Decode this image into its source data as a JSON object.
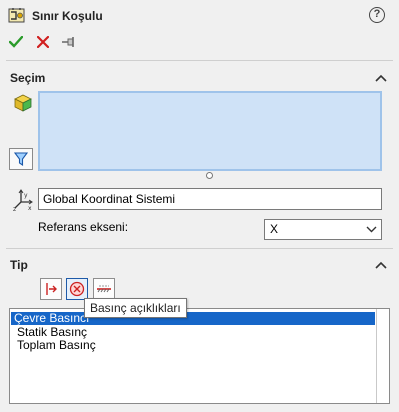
{
  "header": {
    "title": "Sınır Koşulu",
    "help": "?"
  },
  "toolbar": {
    "ok": "ok",
    "cancel": "cancel",
    "pin": "pin"
  },
  "selection_section": {
    "title": "Seçim",
    "coordinate_system_value": "Global Koordinat Sistemi",
    "reference_axis_label": "Referans ekseni:",
    "reference_axis_value": "X"
  },
  "type_section": {
    "title": "Tip",
    "tooltip": "Basınç açıklıkları",
    "items": [
      "Çevre Basıncı",
      "Statik Basınç",
      "Toplam Basınç"
    ],
    "selected_index": 0
  },
  "colors": {
    "selection_box": "#cfe2f7",
    "list_highlight": "#1666c8",
    "ok_green": "#2a9b2a",
    "cancel_red": "#d11f1f"
  }
}
